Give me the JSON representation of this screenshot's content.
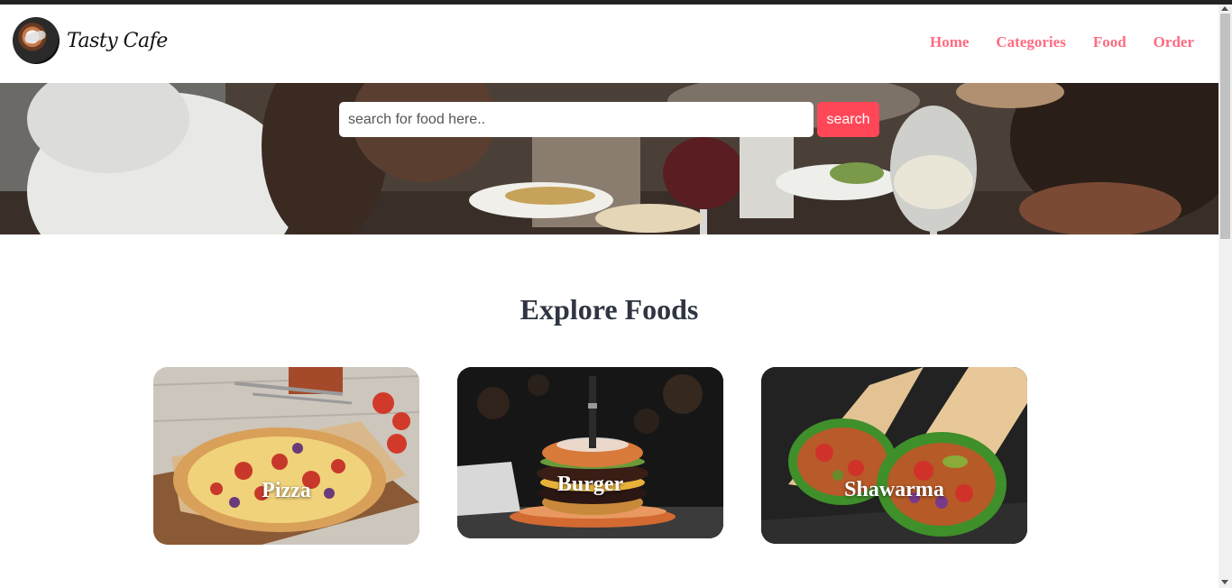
{
  "brand": {
    "name": "Tasty Cafe",
    "logo_icon": "coffee-cup-logo"
  },
  "nav": {
    "items": [
      {
        "label": "Home"
      },
      {
        "label": "Categories"
      },
      {
        "label": "Food"
      },
      {
        "label": "Order"
      }
    ]
  },
  "search": {
    "placeholder": "search for food here..",
    "value": "",
    "button_label": "search"
  },
  "explore": {
    "title": "Explore Foods",
    "items": [
      {
        "label": "Pizza",
        "image": "pizza-photo"
      },
      {
        "label": "Burger",
        "image": "burger-photo"
      },
      {
        "label": "Shawarma",
        "image": "shawarma-photo"
      }
    ]
  },
  "colors": {
    "accent": "#ff4757",
    "nav_link": "#ff6b81",
    "heading": "#2f3542",
    "top_bar": "#222222"
  }
}
